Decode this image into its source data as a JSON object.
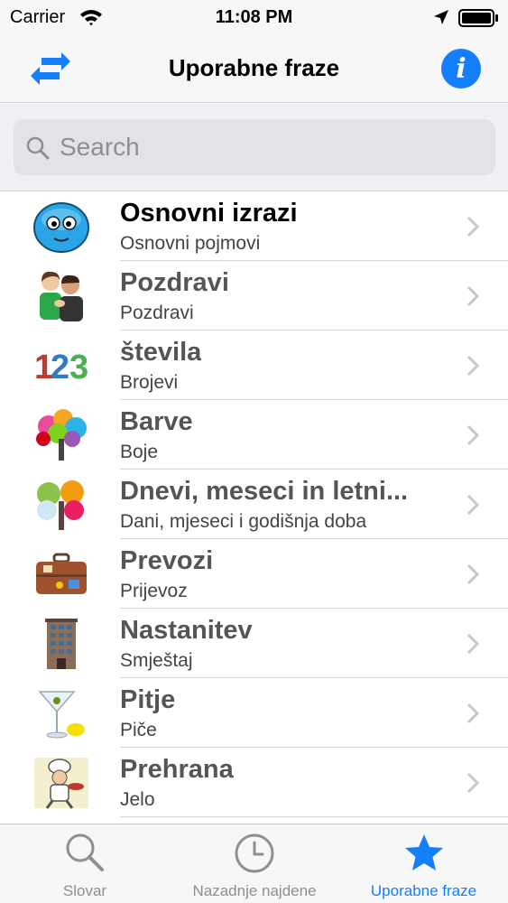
{
  "status_bar": {
    "carrier": "Carrier",
    "time": "11:08 PM"
  },
  "nav": {
    "title": "Uporabne fraze",
    "info_label": "i"
  },
  "search": {
    "placeholder": "Search"
  },
  "items": [
    {
      "title": "Osnovni izrazi",
      "subtitle": "Osnovni pojmovi",
      "icon": "smiley-face-icon"
    },
    {
      "title": "Pozdravi",
      "subtitle": "Pozdravi",
      "icon": "people-greeting-icon"
    },
    {
      "title": "števila",
      "subtitle": "Brojevi",
      "icon": "numbers-123-icon"
    },
    {
      "title": "Barve",
      "subtitle": "Boje",
      "icon": "colorful-tree-icon"
    },
    {
      "title": "Dnevi, meseci in letni...",
      "subtitle": "Dani, mjeseci i godišnja doba",
      "icon": "seasons-tree-icon"
    },
    {
      "title": "Prevozi",
      "subtitle": "Prijevoz",
      "icon": "suitcase-icon"
    },
    {
      "title": "Nastanitev",
      "subtitle": "Smještaj",
      "icon": "hotel-building-icon"
    },
    {
      "title": "Pitje",
      "subtitle": "Piče",
      "icon": "martini-glass-icon"
    },
    {
      "title": "Prehrana",
      "subtitle": "Jelo",
      "icon": "chef-icon"
    }
  ],
  "numbers_icon_text": [
    "1",
    "2",
    "3"
  ],
  "tabs": [
    {
      "label": "Slovar",
      "icon": "search-icon",
      "active": false
    },
    {
      "label": "Nazadnje najdene",
      "icon": "clock-icon",
      "active": false
    },
    {
      "label": "Uporabne fraze",
      "icon": "star-icon",
      "active": true
    }
  ],
  "colors": {
    "accent": "#157efb",
    "inactive": "#8e8e93",
    "background": "#efeff4"
  }
}
